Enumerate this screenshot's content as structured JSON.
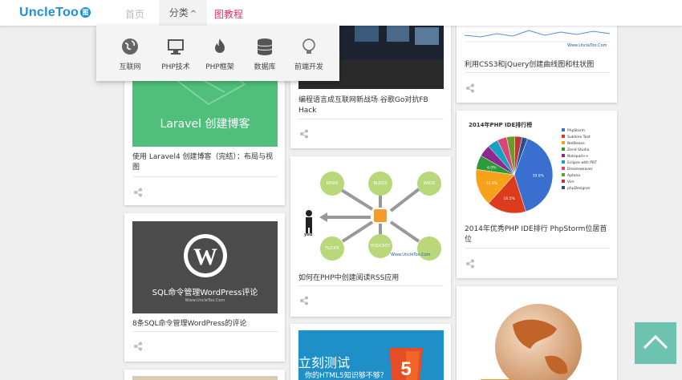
{
  "header": {
    "logo": "UncleToo",
    "logo_badge": "图",
    "nav": {
      "home": "首页",
      "category": "分类",
      "tutorial": "图教程"
    }
  },
  "dropdown": {
    "items": [
      {
        "label": "互联网",
        "icon": "globe-icon"
      },
      {
        "label": "PHP技术",
        "icon": "monitor-icon"
      },
      {
        "label": "PHP框架",
        "icon": "flame-icon"
      },
      {
        "label": "数据库",
        "icon": "database-icon"
      },
      {
        "label": "前端开发",
        "icon": "lightbulb-icon"
      }
    ]
  },
  "cards": {
    "laravel": {
      "banner": "Laravel 创建博客",
      "title": "使用 Laravel4 创建博客（完结）：布局与视图"
    },
    "wordpress": {
      "banner": "SQL命令管理WordPress评论",
      "watermark": "Www.UncleToo.Com",
      "title": "8条SQL命令管理WordPress的评论"
    },
    "golang": {
      "title": "编程语言成互联网新战场 谷歌Go对抗FB Hack"
    },
    "rss": {
      "bubbles": [
        "NEWS",
        "BLOGS",
        "WIKIS",
        "FLICKR",
        "PODCAST"
      ],
      "person": "you",
      "watermark": "Www.UncleToo.Com",
      "title": "如何在PHP中创建阅读RSS应用"
    },
    "html5": {
      "banner": "立刻测试",
      "sub": "你的HTML5知识够不够？"
    },
    "jquery": {
      "watermark": "Www.UncleToo.Com",
      "title": "利用CSS3和jQuery创建曲线图和柱状图"
    },
    "phpide": {
      "chart_title": "2014年PHP IDE排行榜",
      "title": "2014年优秀PHP IDE排行 PhpStorm位居首位",
      "pie_labels": [
        "39.6%",
        "16.5%",
        "15.6%",
        "6.0%"
      ]
    }
  },
  "chart_data": {
    "type": "pie",
    "title": "2014年PHP IDE排行榜",
    "categories": [
      "PhpStorm",
      "Sublime Text",
      "NetBeans",
      "Zend Studio",
      "Notepad++",
      "Eclipse with PDT",
      "Dreamweaver",
      "Aptana",
      "Vim",
      "phpDesigner"
    ],
    "values": [
      39.6,
      16.5,
      15.6,
      6.0,
      5.0,
      4.5,
      4.0,
      3.5,
      3.0,
      2.3
    ],
    "colors": [
      "#3a6fcf",
      "#dc3b1c",
      "#f7a21b",
      "#2e9a3a",
      "#8e2a8e",
      "#1a9fc4",
      "#d9467a",
      "#6a9a2a",
      "#b83a3a",
      "#2a4f8a"
    ],
    "legend": "right"
  },
  "colors": {
    "accent": "#1e8fd8",
    "tutorial": "#e0336c",
    "laravel_green": "#4fbf7b",
    "to_top": "#6cc4b0"
  }
}
